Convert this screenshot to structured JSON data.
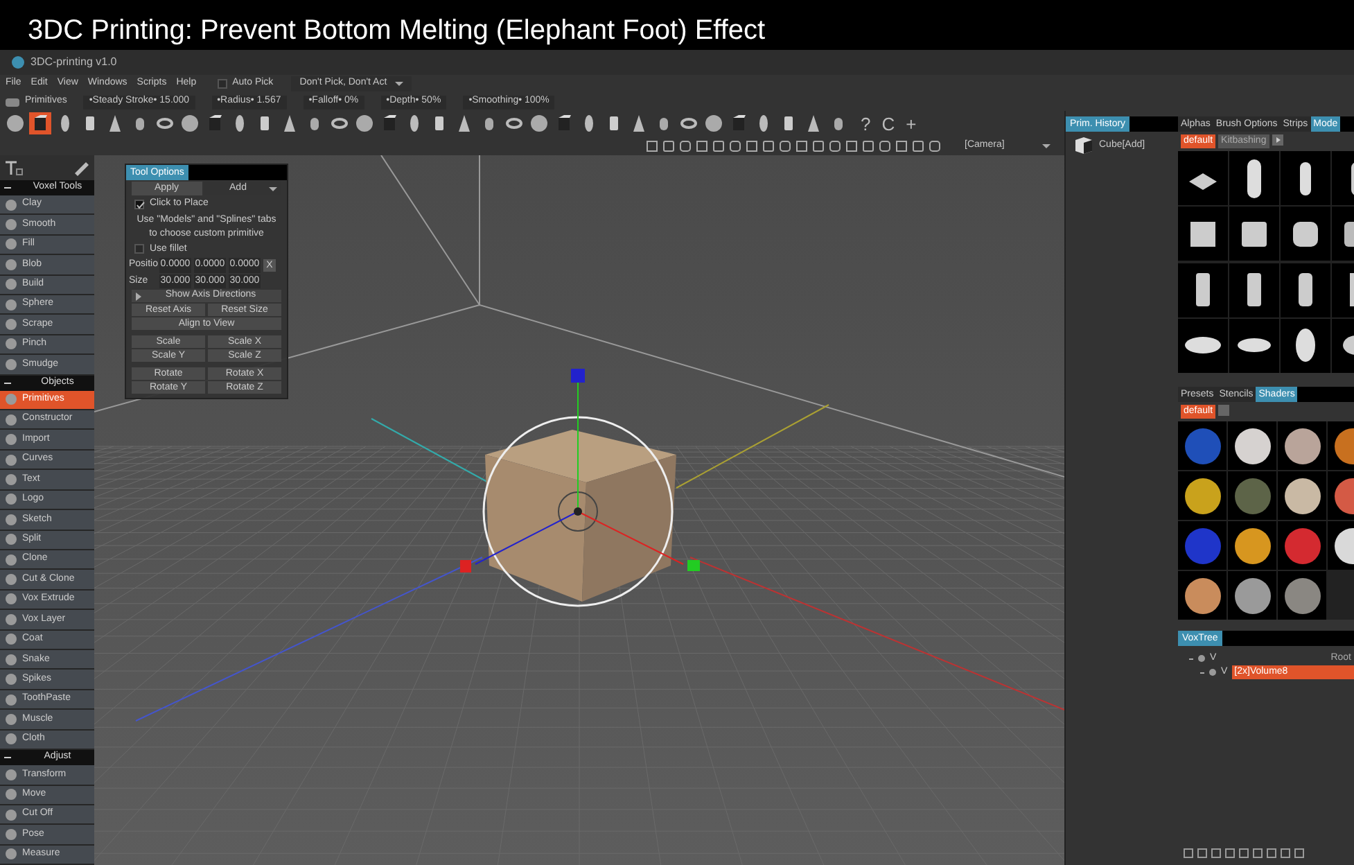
{
  "video_title": "3DC Printing: Prevent Bottom Melting (Elephant Foot) Effect",
  "app": {
    "title": "3DC-printing v1.0"
  },
  "menu": [
    "File",
    "Edit",
    "View",
    "Windows",
    "Scripts",
    "Help"
  ],
  "auto_pick": {
    "label": "Auto Pick",
    "checked": false
  },
  "pick_mode": "Don't Pick, Don't Act",
  "brush_bar": {
    "mode": "Primitives",
    "params": [
      {
        "label": "•Steady Stroke•",
        "value": "15.000"
      },
      {
        "label": "•Radius•",
        "value": "1.567"
      },
      {
        "label": "•Falloff•",
        "value": "0%"
      },
      {
        "label": "•Depth•",
        "value": "50%"
      },
      {
        "label": "•Smoothing•",
        "value": "100%"
      }
    ]
  },
  "primitive_toolbar": [
    {
      "selected": false
    },
    {
      "selected": true
    },
    {
      "selected": false
    },
    {
      "selected": false
    },
    {
      "selected": false
    },
    {
      "selected": false
    },
    {
      "selected": false
    },
    {
      "selected": false
    },
    {
      "selected": false
    },
    {
      "selected": false
    },
    {
      "selected": false
    },
    {
      "selected": false
    },
    {
      "selected": false
    },
    {
      "selected": false
    },
    {
      "selected": false
    },
    {
      "selected": false
    },
    {
      "selected": false
    },
    {
      "selected": false
    },
    {
      "selected": false
    },
    {
      "selected": false
    },
    {
      "selected": false
    },
    {
      "selected": false
    },
    {
      "selected": false
    },
    {
      "selected": false
    },
    {
      "selected": false
    },
    {
      "selected": false
    },
    {
      "selected": false
    },
    {
      "selected": false
    },
    {
      "selected": false
    },
    {
      "selected": false
    },
    {
      "selected": false
    },
    {
      "selected": false
    },
    {
      "selected": false
    },
    {
      "selected": false
    }
  ],
  "view_toolbar": {
    "symbols": [
      "?",
      "C",
      "+"
    ],
    "camera": "[Camera]"
  },
  "tool_sections": [
    {
      "title": "Voxel Tools",
      "expanded": true,
      "items": [
        {
          "label": "Clay",
          "selected": false
        },
        {
          "label": "Smooth",
          "selected": false
        },
        {
          "label": "Fill",
          "selected": false
        },
        {
          "label": "Blob",
          "selected": false
        },
        {
          "label": "Build",
          "selected": false
        },
        {
          "label": "Sphere",
          "selected": false
        },
        {
          "label": "Scrape",
          "selected": false
        },
        {
          "label": "Pinch",
          "selected": false
        },
        {
          "label": "Smudge",
          "selected": false
        }
      ]
    },
    {
      "title": "Objects",
      "expanded": true,
      "items": [
        {
          "label": "Primitives",
          "selected": true
        },
        {
          "label": "Constructor",
          "selected": false
        },
        {
          "label": "Import",
          "selected": false
        },
        {
          "label": "Curves",
          "selected": false
        },
        {
          "label": "Text",
          "selected": false
        },
        {
          "label": "Logo",
          "selected": false
        },
        {
          "label": "Sketch",
          "selected": false
        },
        {
          "label": "Split",
          "selected": false
        },
        {
          "label": "Clone",
          "selected": false
        },
        {
          "label": "Cut & Clone",
          "selected": false
        },
        {
          "label": "Vox Extrude",
          "selected": false
        },
        {
          "label": "Vox Layer",
          "selected": false
        },
        {
          "label": "Coat",
          "selected": false
        },
        {
          "label": "Snake",
          "selected": false
        },
        {
          "label": "Spikes",
          "selected": false
        },
        {
          "label": "ToothPaste",
          "selected": false
        },
        {
          "label": "Muscle",
          "selected": false
        },
        {
          "label": "Cloth",
          "selected": false
        }
      ]
    },
    {
      "title": "Adjust",
      "expanded": true,
      "items": [
        {
          "label": "Transform",
          "selected": false
        },
        {
          "label": "Move",
          "selected": false
        },
        {
          "label": "Cut Off",
          "selected": false
        },
        {
          "label": "Pose",
          "selected": false
        },
        {
          "label": "Measure",
          "selected": false
        }
      ]
    }
  ],
  "tool_options": {
    "title": "Tool Options",
    "apply": "Apply",
    "add_mode": "Add",
    "click_to_place": {
      "label": "Click to Place",
      "checked": true
    },
    "hint": "Use \"Models\" and \"Splines\" tabs to choose custom primitive",
    "use_fillet": {
      "label": "Use fillet",
      "checked": false
    },
    "position": {
      "label": "Positio",
      "values": [
        "0.0000",
        "0.0000",
        "0.0000"
      ],
      "reset": "X"
    },
    "size": {
      "label": "Size",
      "values": [
        "30.000",
        "30.000",
        "30.000"
      ]
    },
    "show_axis": {
      "label": "Show Axis Directions",
      "expanded": false
    },
    "button_rows": [
      [
        "Reset Axis",
        "Reset Size"
      ],
      [
        "Align to View"
      ],
      [
        "Scale",
        "Scale X"
      ],
      [
        "Scale Y",
        "Scale Z"
      ],
      [
        "Rotate",
        "Rotate X"
      ],
      [
        "Rotate Y",
        "Rotate Z"
      ]
    ]
  },
  "prim_history": {
    "title": "Prim. History",
    "items": [
      {
        "label": "Cube[Add]"
      }
    ]
  },
  "top_tabs": [
    {
      "label": "Alphas",
      "selected": false
    },
    {
      "label": "Brush Options",
      "selected": false
    },
    {
      "label": "Strips",
      "selected": false
    },
    {
      "label": "Mode",
      "selected": true
    }
  ],
  "model_filters": [
    {
      "label": "default",
      "selected": true
    },
    {
      "label": "Kitbashing",
      "selected": false
    }
  ],
  "bottom_tabs": [
    {
      "label": "Presets",
      "selected": false
    },
    {
      "label": "Stencils",
      "selected": false
    },
    {
      "label": "Shaders",
      "selected": true
    }
  ],
  "shader_filter": {
    "label": "default",
    "selected": true
  },
  "shaders": [
    {
      "color": "#1f4fb8"
    },
    {
      "color": "#d6d2d0"
    },
    {
      "color": "#b9a49a"
    },
    {
      "color": "#c8701f"
    },
    {
      "color": "#c9a21c"
    },
    {
      "color": "#5d6448"
    },
    {
      "color": "#c9b9a4"
    },
    {
      "color": "#d45a45"
    },
    {
      "color": "#1f35c9"
    },
    {
      "color": "#d7961f"
    },
    {
      "color": "#d42a30"
    },
    {
      "color": "#d9d9d9"
    },
    {
      "color": "#c98c5c"
    },
    {
      "color": "#9a9a9a"
    },
    {
      "color": "#8a8782"
    }
  ],
  "voxtree": {
    "title": "VoxTree",
    "nodes": [
      {
        "label": "V",
        "name": "Root",
        "selected": false,
        "children": [
          {
            "label": "V",
            "name": "[2x]Volume8",
            "selected": true
          }
        ]
      }
    ]
  }
}
